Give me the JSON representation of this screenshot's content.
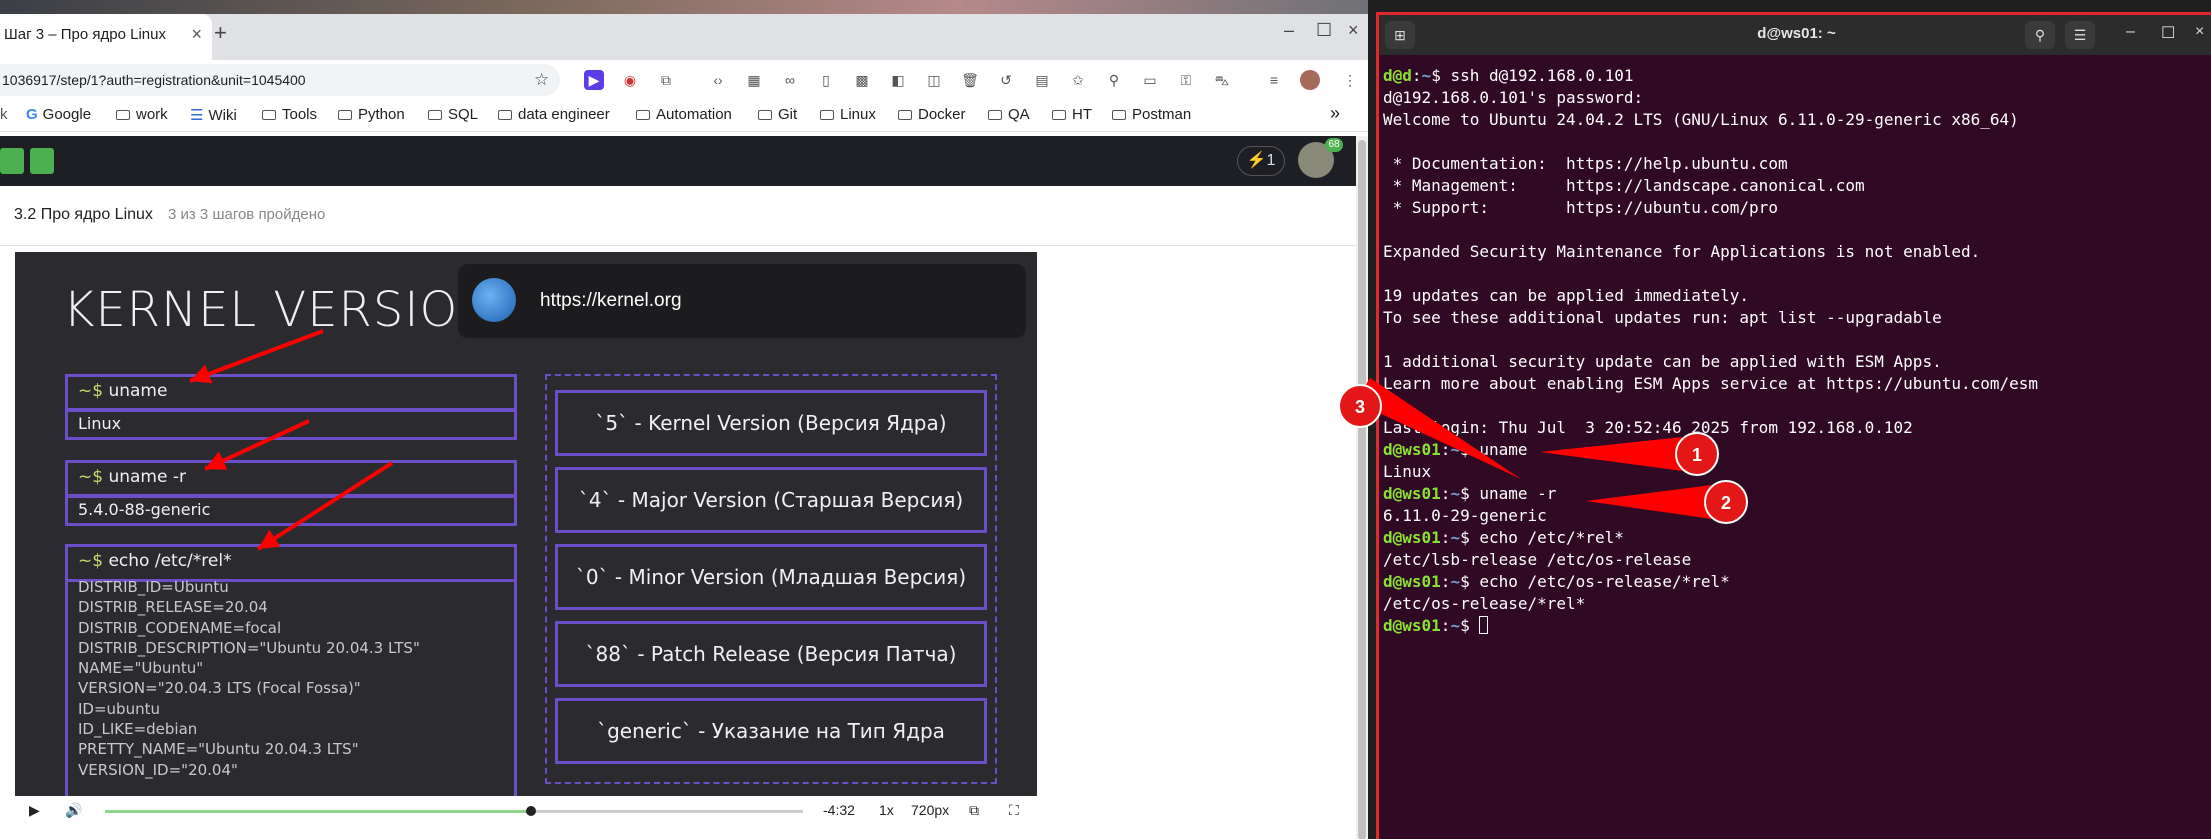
{
  "browser": {
    "tab_title": "Шаг 3 – Про ядро Linux",
    "tab_close": "×",
    "new_tab": "+",
    "window_controls": [
      "–",
      "☐",
      "×"
    ],
    "url": "1036917/step/1?auth=registration&unit=1045400",
    "bookmarks": [
      "Google",
      "work",
      "Wiki",
      "Tools",
      "Python",
      "SQL",
      "data engineer",
      "Automation",
      "Git",
      "Linux",
      "Docker",
      "QA",
      "HT",
      "Postman"
    ],
    "bookmarks_more": "»"
  },
  "stepik": {
    "steps_counter": "1",
    "avatar_badge": "68",
    "lesson_title": "3.2 Про ядро Linux",
    "lesson_progress": "3 из 3 шагов пройдено"
  },
  "video": {
    "title": "KERNEL VERSIONS",
    "url_pill": "https://kernel.org",
    "prompt": "~$",
    "commands": [
      "uname",
      "uname  -r",
      "echo  /etc/*rel*"
    ],
    "outputs": [
      "Linux",
      "5.4.0-88-generic"
    ],
    "distrib_lines": [
      "DISTRIB_ID=Ubuntu",
      "DISTRIB_RELEASE=20.04",
      "DISTRIB_CODENAME=focal",
      "DISTRIB_DESCRIPTION=\"Ubuntu 20.04.3 LTS\"",
      "NAME=\"Ubuntu\"",
      "VERSION=\"20.04.3 LTS (Focal Fossa)\"",
      "ID=ubuntu",
      "ID_LIKE=debian",
      "PRETTY_NAME=\"Ubuntu 20.04.3 LTS\"",
      "VERSION_ID=\"20.04\""
    ],
    "version_boxes": [
      "`5`  -  Kernel  Version (Версия Ядра)",
      "`4`  -  Major  Version (Старшая  Версия)",
      "`0`  -  Minor  Version (Младшая  Версия)",
      "`88`  -  Patch  Release  (Версия  Патча)",
      "`generic` - Указание на Тип Ядра"
    ],
    "controls": {
      "time_remaining": "-4:32",
      "speed": "1x",
      "quality": "720px",
      "progress_fraction": 0.61
    }
  },
  "terminal": {
    "title": "d@ws01: ~",
    "lines": [
      {
        "prompt": "d@d",
        "path": "~",
        "text": "ssh d@192.168.0.101"
      },
      {
        "text": "d@192.168.0.101's password:"
      },
      {
        "text": "Welcome to Ubuntu 24.04.2 LTS (GNU/Linux 6.11.0-29-generic x86_64)"
      },
      {
        "text": ""
      },
      {
        "text": " * Documentation:  https://help.ubuntu.com"
      },
      {
        "text": " * Management:     https://landscape.canonical.com"
      },
      {
        "text": " * Support:        https://ubuntu.com/pro"
      },
      {
        "text": ""
      },
      {
        "text": "Expanded Security Maintenance for Applications is not enabled."
      },
      {
        "text": ""
      },
      {
        "text": "19 updates can be applied immediately."
      },
      {
        "text": "To see these additional updates run: apt list --upgradable"
      },
      {
        "text": ""
      },
      {
        "text": "1 additional security update can be applied with ESM Apps."
      },
      {
        "text": "Learn more about enabling ESM Apps service at https://ubuntu.com/esm"
      },
      {
        "text": ""
      },
      {
        "text": "Last login: Thu Jul  3 20:52:46 2025 from 192.168.0.102"
      },
      {
        "prompt": "d@ws01",
        "path": "~",
        "text": "uname"
      },
      {
        "text": "Linux"
      },
      {
        "prompt": "d@ws01",
        "path": "~",
        "text": "uname -r"
      },
      {
        "text": "6.11.0-29-generic"
      },
      {
        "prompt": "d@ws01",
        "path": "~",
        "text": "echo /etc/*rel*"
      },
      {
        "text": "/etc/lsb-release /etc/os-release"
      },
      {
        "prompt": "d@ws01",
        "path": "~",
        "text": "echo /etc/os-release/*rel*"
      },
      {
        "text": "/etc/os-release/*rel*"
      },
      {
        "prompt": "d@ws01",
        "path": "~",
        "text": "",
        "cursor": true
      }
    ]
  },
  "annotations": {
    "markers": [
      "1",
      "2",
      "3"
    ],
    "arrow_color": "#ff0000"
  }
}
